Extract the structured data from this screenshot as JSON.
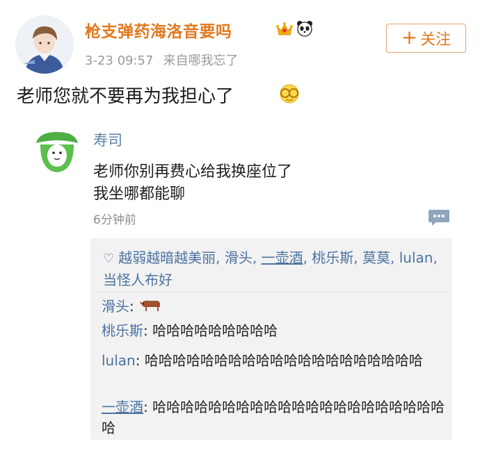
{
  "post": {
    "author": "枪支弹药海洛音要吗",
    "time": "3-23 09:57",
    "source": "来自哪我忘了",
    "follow_label": "关注",
    "text": "老师您就不要再为我担心了"
  },
  "quoted": {
    "author": "寿司",
    "line1": "老师你别再费心给我换座位了",
    "line2": "我坐哪都能聊",
    "time": "6分钟前"
  },
  "likes": {
    "names": [
      "越弱越暗越美丽",
      "滑头",
      "一壶酒",
      "桃乐斯",
      "莫莫",
      "lulan",
      "当怪人布好"
    ]
  },
  "replies": [
    {
      "name": "滑头",
      "text": ""
    },
    {
      "name": "桃乐斯",
      "text": "哈哈哈哈哈哈哈哈哈"
    },
    {
      "name": "lulan",
      "text": "哈哈哈哈哈哈哈哈哈哈哈哈哈哈哈哈哈哈哈哈"
    },
    {
      "name": "一壶酒",
      "text": "哈哈哈哈哈哈哈哈哈哈哈哈哈哈哈哈哈哈哈哈哈哈"
    }
  ],
  "colors": {
    "username": "#e0791f",
    "link": "#4c73a0",
    "reply_bg": "#f2f2f2"
  }
}
